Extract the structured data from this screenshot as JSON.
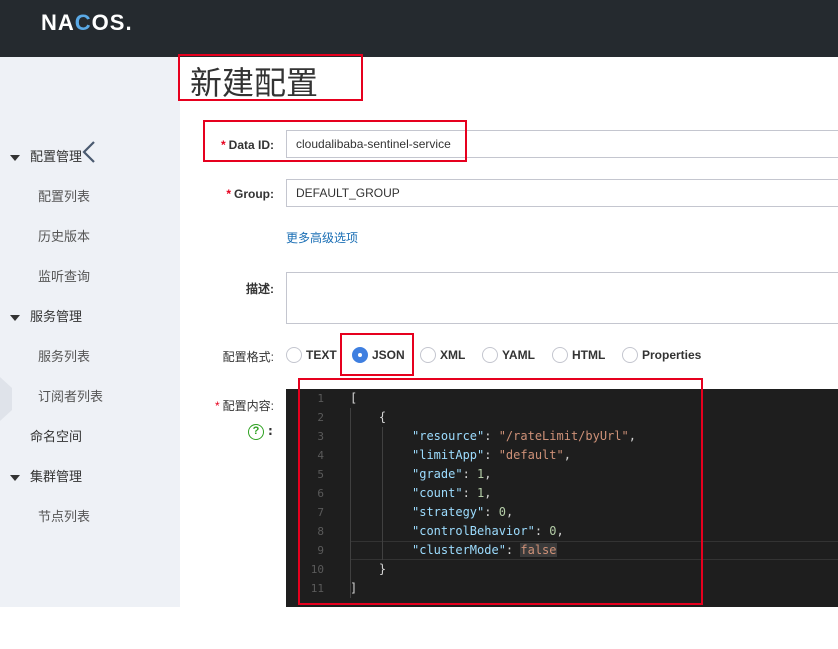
{
  "brand": {
    "logo_text_pre": "NA",
    "logo_text_ring": "C",
    "logo_text_post": "OS."
  },
  "sidebar": {
    "collapse_icon": "chevron-left-icon",
    "groups": [
      {
        "label": "配置管理",
        "items": [
          "配置列表",
          "历史版本",
          "监听查询"
        ]
      },
      {
        "label": "服务管理",
        "items": [
          "服务列表",
          "订阅者列表"
        ]
      },
      {
        "label": "命名空间",
        "items": []
      },
      {
        "label": "集群管理",
        "items": [
          "节点列表"
        ]
      }
    ]
  },
  "page": {
    "title": "新建配置"
  },
  "form": {
    "data_id": {
      "required": "*",
      "label": "Data ID:",
      "value": "cloudalibaba-sentinel-service"
    },
    "group": {
      "required": "*",
      "label": "Group:",
      "value": "DEFAULT_GROUP"
    },
    "advanced_link": "更多高级选项",
    "description": {
      "label": "描述:",
      "value": ""
    },
    "format": {
      "label": "配置格式:",
      "options": [
        "TEXT",
        "JSON",
        "XML",
        "YAML",
        "HTML",
        "Properties"
      ],
      "selected": "JSON"
    },
    "content": {
      "required": "*",
      "label": "配置内容:",
      "help_icon": "question-circle-icon",
      "help_colon": ":"
    }
  },
  "editor": {
    "line_numbers": [
      "1",
      "2",
      "3",
      "4",
      "5",
      "6",
      "7",
      "8",
      "9",
      "10",
      "11"
    ],
    "lines": {
      "l1": "[",
      "l2": "    {",
      "resource_key": "\"resource\"",
      "resource_val": "\"/rateLimit/byUrl\"",
      "limitApp_key": "\"limitApp\"",
      "limitApp_val": "\"default\"",
      "grade_key": "\"grade\"",
      "grade_val": "1",
      "count_key": "\"count\"",
      "count_val": "1",
      "strategy_key": "\"strategy\"",
      "strategy_val": "0",
      "controlBehavior_key": "\"controlBehavior\"",
      "controlBehavior_val": "0",
      "clusterMode_key": "\"clusterMode\"",
      "clusterMode_val": "false",
      "l10": "    }",
      "l11": "]"
    }
  },
  "colors": {
    "topbar": "#252a2f",
    "sidebar": "#eef1f6",
    "highlight_box": "#e6001e",
    "link": "#1b6fb5",
    "radio_on": "#3f7fe0"
  }
}
